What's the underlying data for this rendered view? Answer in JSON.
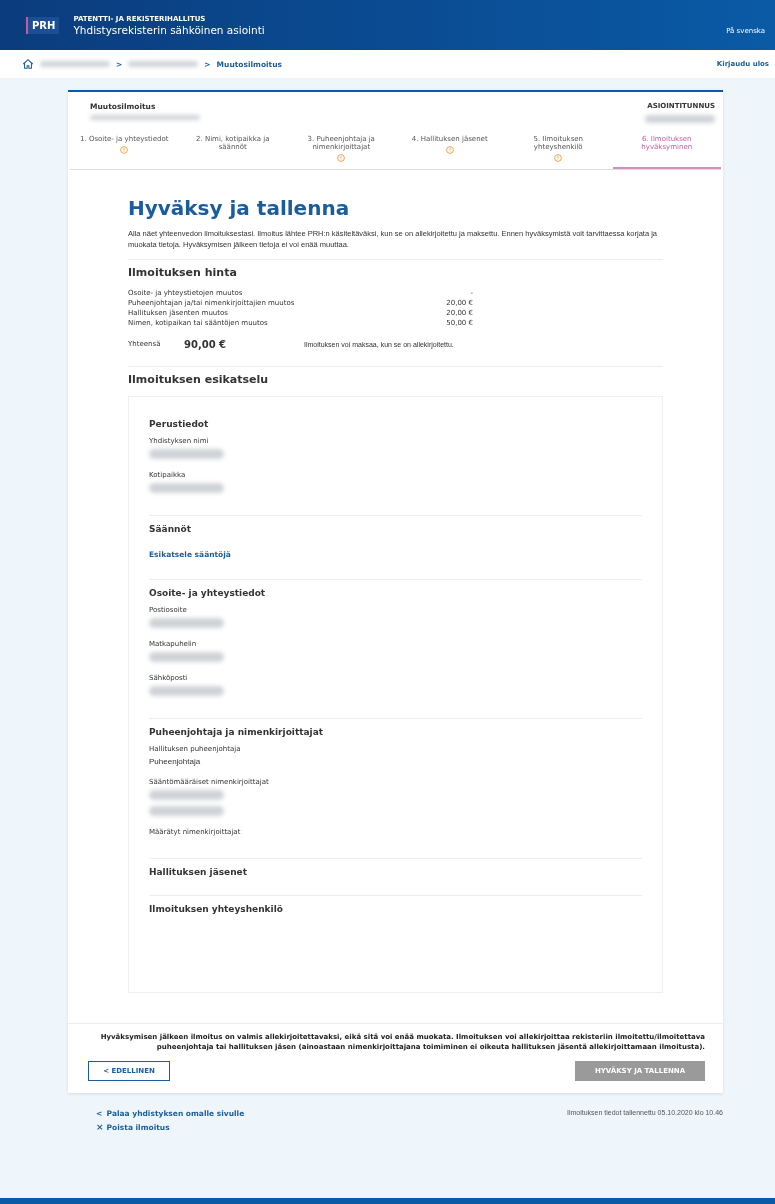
{
  "header": {
    "logo": "PRH",
    "org": "PATENTTI- JA REKISTERIHALLITUS",
    "title": "Yhdistysrekisterin sähköinen asiointi",
    "language_link": "På svenska"
  },
  "breadcrumb": {
    "separator": ">",
    "items": [
      {
        "kind": "blurred"
      },
      {
        "kind": "blurred"
      },
      {
        "kind": "text",
        "text": "Muutosilmoitus"
      }
    ],
    "logout": "Kirjaudu ulos"
  },
  "form_header": {
    "title": "Muutosilmoitus",
    "id_label": "ASIOINTITUNNUS"
  },
  "steps": [
    {
      "label": "1. Osoite- ja yhteystiedot",
      "warning": true,
      "selected": false
    },
    {
      "label": "2. Nimi, kotipaikka ja säännöt",
      "warning": false,
      "selected": false
    },
    {
      "label": "3. Puheenjohtaja ja nimenkirjoittajat",
      "warning": true,
      "selected": false
    },
    {
      "label": "4. Hallituksen jäsenet",
      "warning": true,
      "selected": false
    },
    {
      "label": "5. Ilmoituksen yhteyshenkilö",
      "warning": true,
      "selected": false
    },
    {
      "label": "6. Ilmoituksen hyväksyminen",
      "warning": false,
      "selected": true
    }
  ],
  "page_title": "Hyväksy ja tallenna",
  "intro": "Alla näet yhteenvedon ilmoituksestasi. Ilmoitus lähtee PRH:n käsiteltäväksi, kun se on allekirjoitettu ja maksettu. Ennen hyväksymistä voit tarvittaessa korjata ja muokata tietoja. Hyväksymisen jälkeen tietoja ei voi enää muuttaa.",
  "price": {
    "heading": "Ilmoituksen hinta",
    "rows": [
      {
        "label": "Osoite- ja yhteystietojen muutos",
        "amount": "-"
      },
      {
        "label": "Puheenjohtajan ja/tai nimenkirjoittajien muutos",
        "amount": "20,00 €"
      },
      {
        "label": "Hallituksen jäsenten muutos",
        "amount": "20,00 €"
      },
      {
        "label": "Nimen, kotipaikan tai sääntöjen muutos",
        "amount": "50,00 €"
      }
    ],
    "total_label": "Yhteensä",
    "total": "90,00 €",
    "total_note": "Ilmoituksen voi maksaa, kun se on allekirjoitettu."
  },
  "preview": {
    "heading": "Ilmoituksen esikatselu",
    "sections": [
      {
        "heading": "Perustiedot",
        "fields": [
          {
            "label": "Yhdistyksen nimi",
            "values": [
              {
                "kind": "blurred"
              }
            ]
          },
          {
            "label": "Kotipaikka",
            "values": [
              {
                "kind": "blurred"
              }
            ]
          }
        ]
      },
      {
        "heading": "Säännöt",
        "link": "Esikatsele sääntöjä"
      },
      {
        "heading": "Osoite- ja yhteystiedot",
        "fields": [
          {
            "label": "Postiosoite",
            "values": [
              {
                "kind": "blurred"
              }
            ]
          },
          {
            "label": "Matkapuhelin",
            "values": [
              {
                "kind": "blurred"
              }
            ]
          },
          {
            "label": "Sähköposti",
            "values": [
              {
                "kind": "blurred"
              }
            ]
          }
        ]
      },
      {
        "heading": "Puheenjohtaja ja nimenkirjoittajat",
        "fields": [
          {
            "label": "Hallituksen puheenjohtaja",
            "values": [
              {
                "kind": "text",
                "text": "Puheenjohtaja"
              }
            ]
          },
          {
            "label": "Sääntömääräiset nimenkirjoittajat",
            "values": [
              {
                "kind": "blurred"
              },
              {
                "kind": "blurred"
              }
            ]
          },
          {
            "label": "Määrätyt nimenkirjoittajat"
          }
        ]
      },
      {
        "heading": "Hallituksen jäsenet"
      },
      {
        "heading": "Ilmoituksen yhteyshenkilö"
      }
    ]
  },
  "notice": "Hyväksymisen jälkeen ilmoitus on valmis allekirjoitettavaksi, eikä sitä voi enää muokata. Ilmoituksen voi allekirjoittaa rekisteriin ilmoitettu/ilmoitettava puheenjohtaja tai hallituksen jäsen (ainoastaan nimenkirjoittajana toimiminen ei oikeuta hallituksen jäsentä allekirjoittamaan ilmoitusta).",
  "buttons": {
    "back": "< EDELLINEN",
    "approve": {
      "label": "HYVÄKSY JA TALLENNA",
      "disabled": true
    }
  },
  "footer_links": [
    {
      "kind": "back",
      "icon": "<",
      "label": "Palaa yhdistyksen omalle sivulle"
    },
    {
      "kind": "delete",
      "icon": "×",
      "label": "Poista ilmoitus"
    }
  ],
  "saved_note": "Ilmoituksen tiedot tallennettu 05.10.2020 klo 10.46"
}
